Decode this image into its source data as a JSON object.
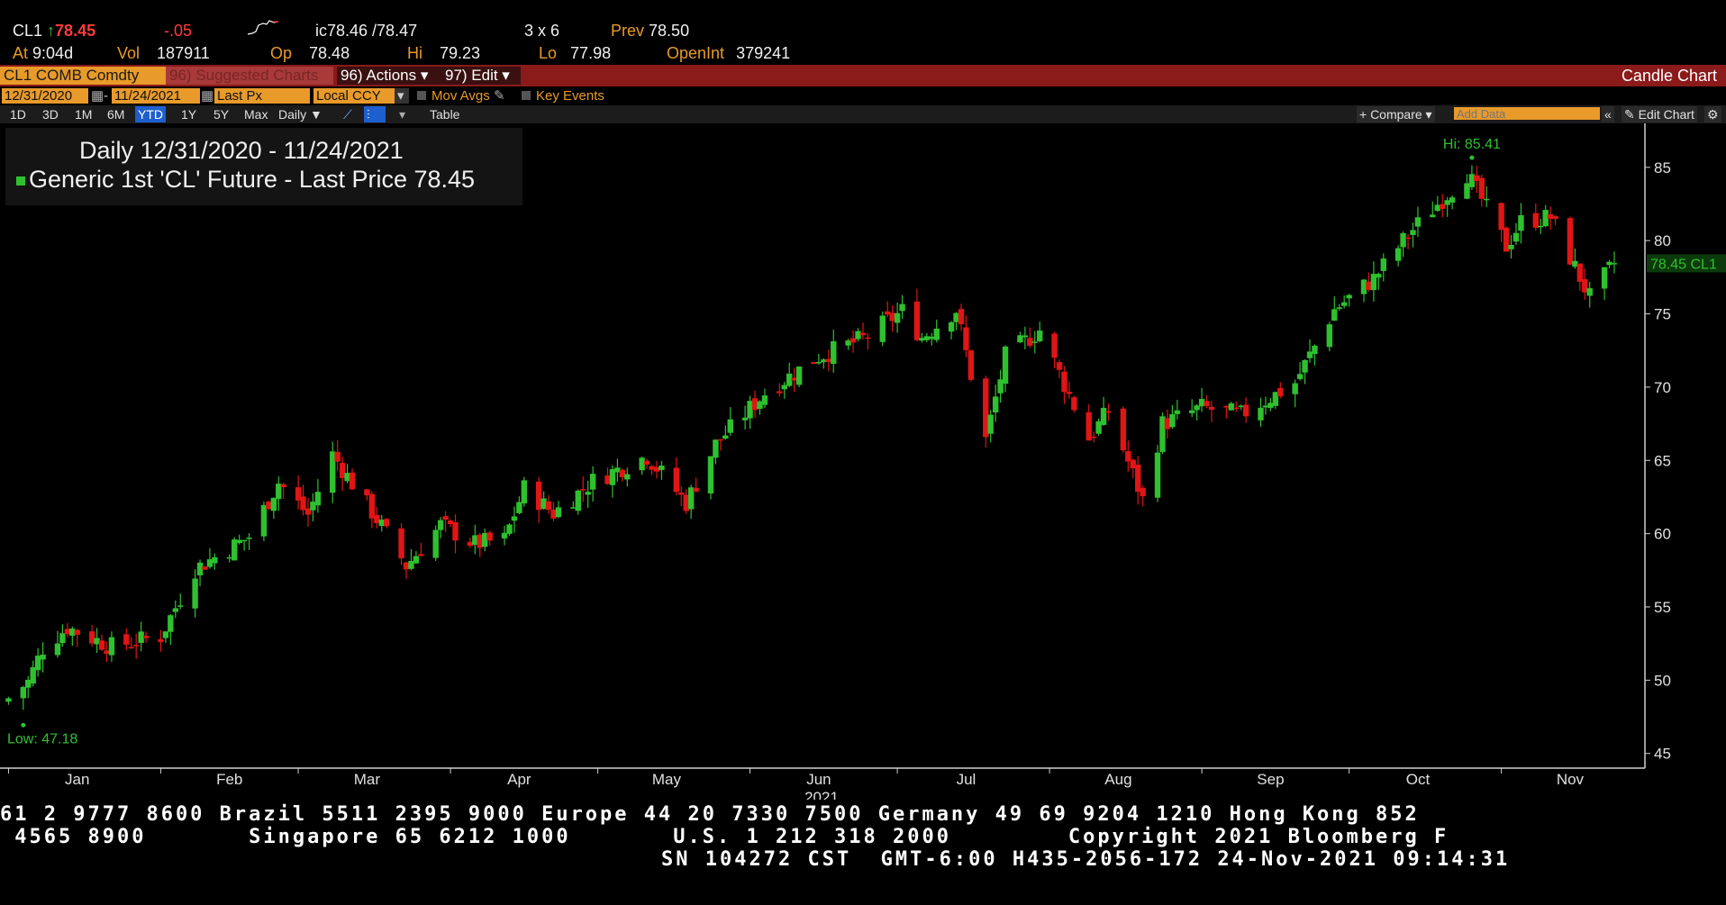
{
  "quote": {
    "ticker": "CL1",
    "arrow": "↑",
    "last": "78.45",
    "change": "-.05",
    "at_label": "At",
    "time": "9:04d",
    "vol_label": "Vol",
    "volume": "187911",
    "op_label": "Op",
    "open": "78.48",
    "hi_label": "Hi",
    "high": "79.23",
    "lo_label": "Lo",
    "low": "77.98",
    "bidask": "ic78.46 /78.47",
    "size": "3 x 6",
    "prev_label": "Prev",
    "prev": "78.50",
    "oi_label": "OpenInt",
    "open_interest": "379241"
  },
  "toolbar": {
    "security": "CL1 COMB Comdty",
    "suggested": "96) Suggested Charts",
    "actions": "96) Actions ▾",
    "edit": "97) Edit ▾",
    "chart_type": "Candle Chart"
  },
  "params": {
    "start_date": "12/31/2020",
    "end_date": "11/24/2021",
    "price_field": "Last Px",
    "currency": "Local CCY",
    "mov_avgs": "Mov Avgs",
    "key_events": "Key Events"
  },
  "periods": [
    "1D",
    "3D",
    "1M",
    "6M",
    "YTD",
    "1Y",
    "5Y",
    "Max"
  ],
  "period_active": "YTD",
  "controls": {
    "frequency": "Daily ▼",
    "table": "Table",
    "compare": "+ Compare ▾",
    "add_data_placeholder": "Add Data",
    "edit_chart": "✎ Edit Chart",
    "collapse": "«",
    "settings": "⚙"
  },
  "legend": {
    "title": "Daily 12/31/2020 - 11/24/2021",
    "series": "Generic 1st 'CL' Future - Last Price 78.45"
  },
  "chart_data": {
    "type": "candlestick",
    "ylim": [
      44,
      88
    ],
    "yticks": [
      45,
      50,
      55,
      60,
      65,
      70,
      75,
      80,
      85
    ],
    "x_month_labels": [
      "Jan",
      "Feb",
      "Mar",
      "Apr",
      "May",
      "Jun",
      "Jul",
      "Aug",
      "Sep",
      "Oct",
      "Nov"
    ],
    "x_year_label": "2021",
    "hi_label": "Hi: 85.41",
    "low_label": "Low: 47.18",
    "last_label": "78.45 CL1",
    "colors": {
      "up": "#2fc02f",
      "down": "#e01515",
      "wick_up": "#2fc02f",
      "wick_down": "#e01515"
    },
    "anchors": [
      {
        "date": "2020-12-31",
        "close": 48.5
      },
      {
        "date": "2021-01-05",
        "close": 49.9
      },
      {
        "date": "2021-01-08",
        "close": 52.2
      },
      {
        "date": "2021-01-13",
        "close": 53.6
      },
      {
        "date": "2021-01-22",
        "close": 52.3
      },
      {
        "date": "2021-02-01",
        "close": 53.0
      },
      {
        "date": "2021-02-08",
        "close": 57.6
      },
      {
        "date": "2021-02-19",
        "close": 59.8
      },
      {
        "date": "2021-02-25",
        "close": 63.5
      },
      {
        "date": "2021-03-03",
        "close": 61.3
      },
      {
        "date": "2021-03-08",
        "close": 65.4
      },
      {
        "date": "2021-03-18",
        "close": 60.5
      },
      {
        "date": "2021-03-23",
        "close": 57.8
      },
      {
        "date": "2021-03-30",
        "close": 60.6
      },
      {
        "date": "2021-04-06",
        "close": 59.3
      },
      {
        "date": "2021-04-12",
        "close": 59.6
      },
      {
        "date": "2021-04-16",
        "close": 63.1
      },
      {
        "date": "2021-04-22",
        "close": 61.4
      },
      {
        "date": "2021-04-30",
        "close": 63.6
      },
      {
        "date": "2021-05-11",
        "close": 65.3
      },
      {
        "date": "2021-05-19",
        "close": 62.1
      },
      {
        "date": "2021-05-25",
        "close": 66.1
      },
      {
        "date": "2021-06-04",
        "close": 69.6
      },
      {
        "date": "2021-06-15",
        "close": 72.1
      },
      {
        "date": "2021-06-24",
        "close": 73.3
      },
      {
        "date": "2021-07-02",
        "close": 75.2
      },
      {
        "date": "2021-07-06",
        "close": 73.4
      },
      {
        "date": "2021-07-13",
        "close": 75.3
      },
      {
        "date": "2021-07-19",
        "close": 66.4
      },
      {
        "date": "2021-07-23",
        "close": 72.1
      },
      {
        "date": "2021-07-30",
        "close": 73.9
      },
      {
        "date": "2021-08-09",
        "close": 66.5
      },
      {
        "date": "2021-08-13",
        "close": 68.4
      },
      {
        "date": "2021-08-20",
        "close": 62.3
      },
      {
        "date": "2021-08-24",
        "close": 67.5
      },
      {
        "date": "2021-09-01",
        "close": 68.6
      },
      {
        "date": "2021-09-09",
        "close": 68.1
      },
      {
        "date": "2021-09-20",
        "close": 70.3
      },
      {
        "date": "2021-09-28",
        "close": 75.3
      },
      {
        "date": "2021-10-06",
        "close": 77.4
      },
      {
        "date": "2021-10-13",
        "close": 80.4
      },
      {
        "date": "2021-10-25",
        "close": 84.6
      },
      {
        "date": "2021-10-28",
        "close": 82.8
      },
      {
        "date": "2021-11-02",
        "close": 79.6
      },
      {
        "date": "2021-11-05",
        "close": 81.3
      },
      {
        "date": "2021-11-11",
        "close": 81.6
      },
      {
        "date": "2021-11-19",
        "close": 76.1
      },
      {
        "date": "2021-11-24",
        "close": 78.45
      }
    ],
    "high_point": {
      "date": "2021-10-26",
      "value": 85.41
    },
    "low_point": {
      "date": "2021-01-04",
      "value": 47.18
    }
  },
  "footer": {
    "line1": "61 2 9777 8600 Brazil 5511 2395 9000 Europe 44 20 7330 7500 Germany 49 69 9204 1210 Hong Kong 852",
    "line2": " 4565 8900       Singapore 65 6212 1000       U.S. 1 212 318 2000        Copyright 2021 Bloomberg F",
    "line3": "SN 104272 CST  GMT-6:00 H435-2056-172 24-Nov-2021 09:14:31"
  }
}
